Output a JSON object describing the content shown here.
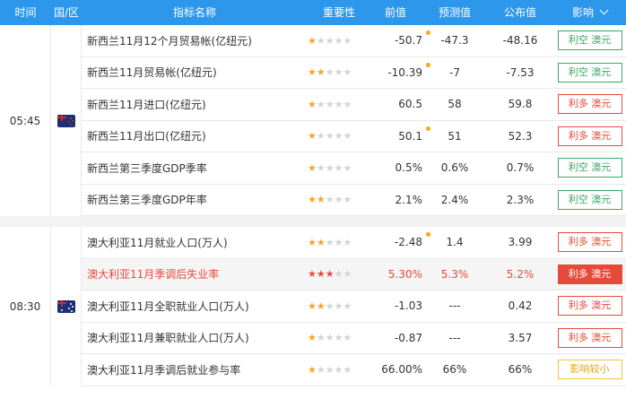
{
  "header": {
    "time": "时间",
    "region": "国/区",
    "indicator": "指标名称",
    "importance": "重要性",
    "previous": "前值",
    "forecast": "预测值",
    "actual": "公布值",
    "impact": "影响"
  },
  "groups": [
    {
      "time": "05:45",
      "flag": "new-zealand-flag-icon",
      "rows": [
        {
          "name": "新西兰11月12个月贸易帐(亿纽元)",
          "stars": 1,
          "prev": "-50.7",
          "revised": true,
          "forecast": "-47.3",
          "actual": "-48.16",
          "impact": "利空 澳元",
          "impact_type": "green"
        },
        {
          "name": "新西兰11月贸易帐(亿纽元)",
          "stars": 2,
          "prev": "-10.39",
          "revised": true,
          "forecast": "-7",
          "actual": "-7.53",
          "impact": "利空 澳元",
          "impact_type": "green"
        },
        {
          "name": "新西兰11月进口(亿纽元)",
          "stars": 1,
          "prev": "60.5",
          "revised": false,
          "forecast": "58",
          "actual": "59.8",
          "impact": "利多 澳元",
          "impact_type": "red"
        },
        {
          "name": "新西兰11月出口(亿纽元)",
          "stars": 1,
          "prev": "50.1",
          "revised": true,
          "forecast": "51",
          "actual": "52.3",
          "impact": "利多 澳元",
          "impact_type": "red"
        },
        {
          "name": "新西兰第三季度GDP季率",
          "stars": 1,
          "prev": "0.5%",
          "revised": false,
          "forecast": "0.6%",
          "actual": "0.7%",
          "impact": "利空 澳元",
          "impact_type": "green"
        },
        {
          "name": "新西兰第三季度GDP年率",
          "stars": 2,
          "prev": "2.1%",
          "revised": false,
          "forecast": "2.4%",
          "actual": "2.3%",
          "impact": "利空 澳元",
          "impact_type": "green"
        }
      ]
    },
    {
      "time": "08:30",
      "flag": "australia-flag-icon",
      "rows": [
        {
          "name": "澳大利亚11月就业人口(万人)",
          "stars": 2,
          "prev": "-2.48",
          "revised": true,
          "forecast": "1.4",
          "actual": "3.99",
          "impact": "利多 澳元",
          "impact_type": "red"
        },
        {
          "name": "澳大利亚11月季调后失业率",
          "stars": 3,
          "prev": "5.30%",
          "revised": false,
          "forecast": "5.3%",
          "actual": "5.2%",
          "impact": "利多 澳元",
          "impact_type": "redfill",
          "highlight": true
        },
        {
          "name": "澳大利亚11月全职就业人口(万人)",
          "stars": 2,
          "prev": "-1.03",
          "revised": false,
          "forecast": "---",
          "actual": "0.42",
          "impact": "利多 澳元",
          "impact_type": "red"
        },
        {
          "name": "澳大利亚11月兼职就业人口(万人)",
          "stars": 1,
          "prev": "-0.87",
          "revised": false,
          "forecast": "---",
          "actual": "3.57",
          "impact": "利多 澳元",
          "impact_type": "red"
        },
        {
          "name": "澳大利亚11月季调后就业参与率",
          "stars": 1,
          "prev": "66.00%",
          "revised": false,
          "forecast": "66%",
          "actual": "66%",
          "impact": "影响较小",
          "impact_type": "yellow"
        }
      ]
    }
  ],
  "colors": {
    "header_bg": "#2d97ec",
    "star_on": "#f5a623",
    "bullish": "#e64a3a",
    "bearish": "#3aa864",
    "neutral": "#e0a800"
  }
}
